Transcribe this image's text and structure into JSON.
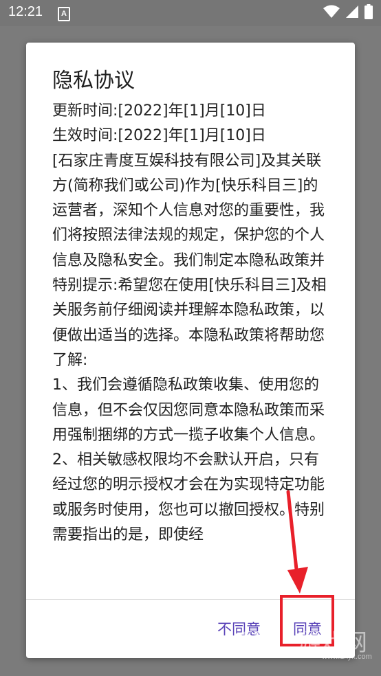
{
  "status_bar": {
    "time": "12:21",
    "notification_letter": "A"
  },
  "dialog": {
    "title": "隐私协议",
    "body": "更新时间:[2022]年[1]月[10]日\n生效时间:[2022]年[1]月[10]日\n[石家庄青度互娱科技有限公司]及其关联方(简称我们或公司)作为[快乐科目三]的运营者，深知个人信息对您的重要性，我们将按照法律法规的规定，保护您的个人信息及隐私安全。我们制定本隐私政策并特别提示:希望您在使用[快乐科目三]及相关服务前仔细阅读并理解本隐私政策，以便做出适当的选择。本隐私政策将帮助您了解:\n1、我们会遵循隐私政策收集、使用您的信息，但不会仅因您同意本隐私政策而采用强制捆绑的方式一揽子收集个人信息。\n2、相关敏感权限均不会默认开启，只有经过您的明示授权才会在为实现特定功能或服务时使用，您也可以撤回授权。特别需要指出的是，即使经",
    "disagree_label": "不同意",
    "agree_label": "同意"
  },
  "annotation": {
    "color": "#e8202a"
  },
  "watermark": {
    "logo": "1K",
    "name": "游戏网",
    "url": "www.1kyx.com"
  },
  "colors": {
    "accent": "#5a43b8",
    "scrim": "#7b7b7b"
  }
}
